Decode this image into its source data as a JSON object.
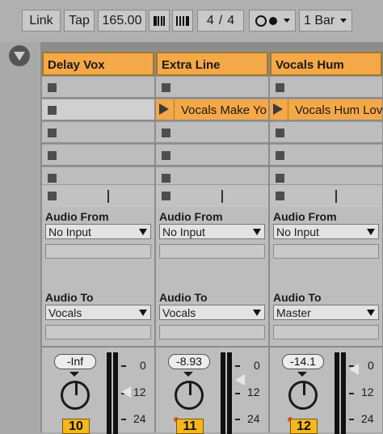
{
  "transport": {
    "link": "Link",
    "tap": "Tap",
    "tempo": "165.00",
    "time_signature_num": "4",
    "time_signature_sep": "/",
    "time_signature_den": "4",
    "quantization": "1 Bar"
  },
  "tracks": [
    {
      "name": "Delay Vox",
      "clips": [
        "",
        "",
        "",
        "",
        "",
        ""
      ],
      "audio_from_label": "Audio From",
      "audio_from": "No Input",
      "audio_to_label": "Audio To",
      "audio_to": "Vocals",
      "volume": "-Inf",
      "number": "10"
    },
    {
      "name": "Extra Line",
      "clips": [
        "",
        "Vocals Make Yo",
        "",
        "",
        "",
        ""
      ],
      "audio_from_label": "Audio From",
      "audio_from": "No Input",
      "audio_to_label": "Audio To",
      "audio_to": "Vocals",
      "volume": "-8.93",
      "number": "11"
    },
    {
      "name": "Vocals Hum",
      "clips": [
        "",
        "Vocals Hum Lov",
        "",
        "",
        "",
        ""
      ],
      "audio_from_label": "Audio From",
      "audio_from": "No Input",
      "audio_to_label": "Audio To",
      "audio_to": "Master",
      "volume": "-14.1",
      "number": "12"
    }
  ],
  "meter_scale": [
    "0",
    "12",
    "24"
  ],
  "colors": {
    "track_header": "#f5a847",
    "track_number": "#f5b71a",
    "background": "#a9a9a9"
  },
  "icons": {
    "collapse": "triangle-down-icon",
    "clip_play": "play-icon",
    "clip_stop": "stop-square-icon",
    "metronome": "metronome-icon",
    "record": "record-icon"
  }
}
